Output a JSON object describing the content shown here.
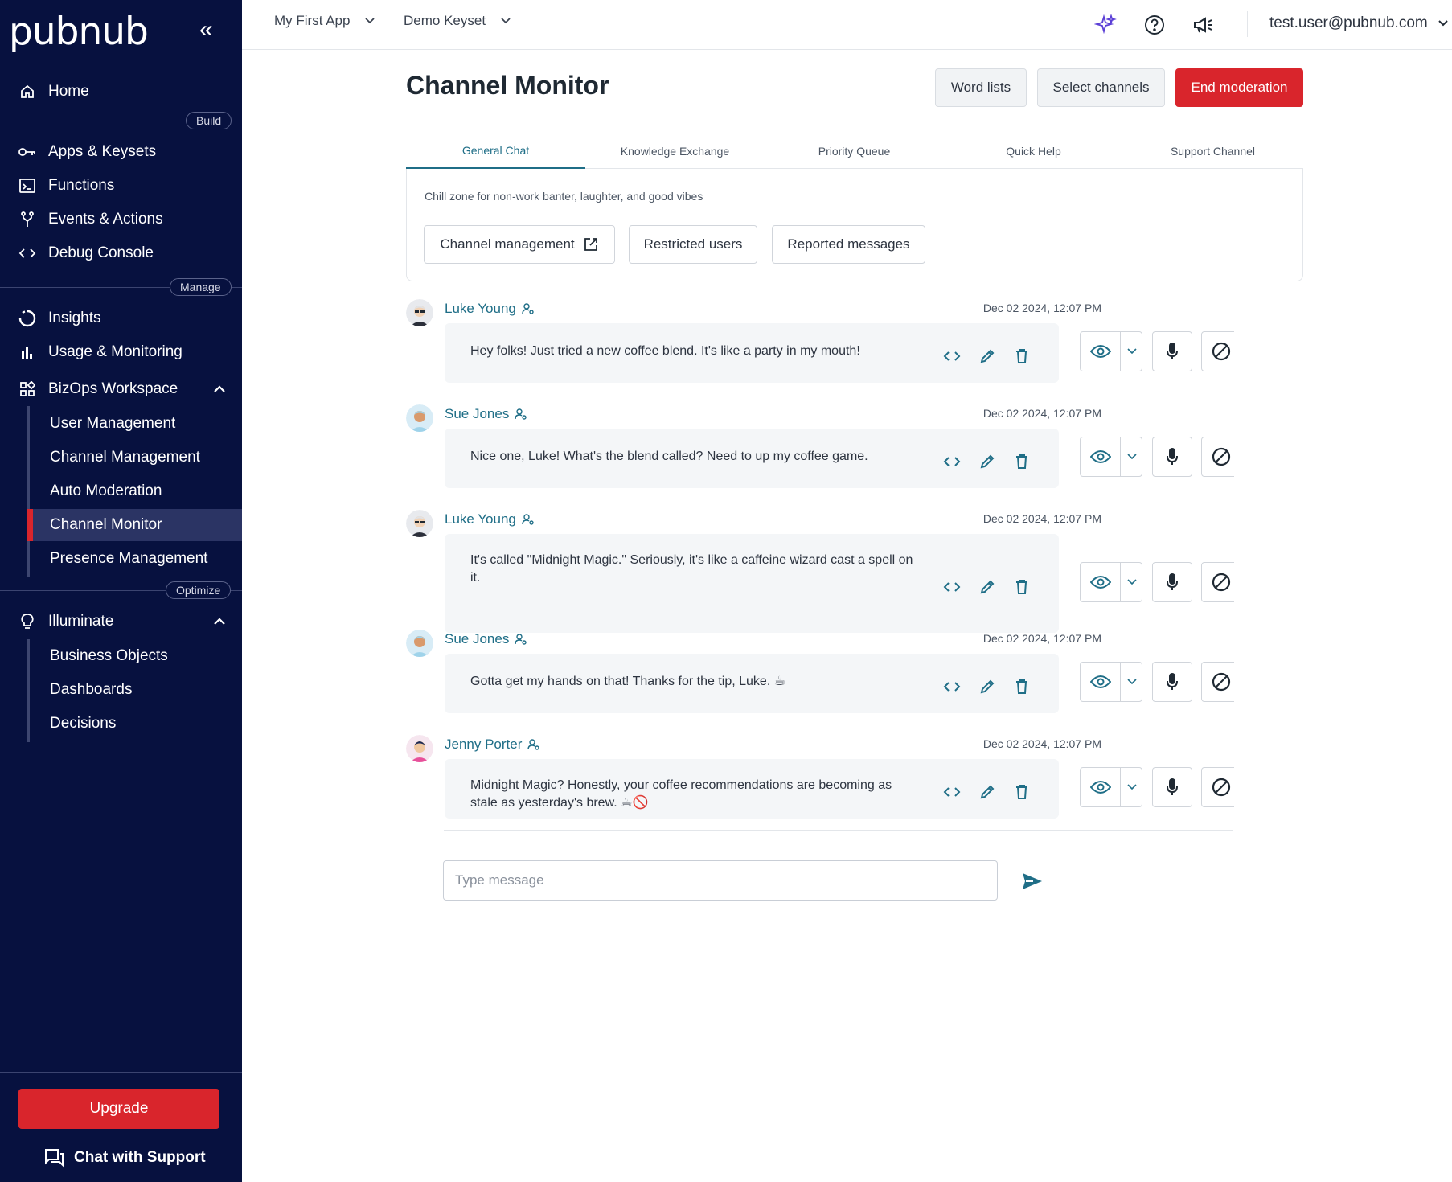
{
  "sidebar": {
    "logo": "pubnub",
    "collapse_glyph": "«",
    "home": "Home",
    "sections": {
      "build": "Build",
      "manage": "Manage",
      "optimize": "Optimize"
    },
    "build_items": [
      "Apps & Keysets",
      "Functions",
      "Events & Actions",
      "Debug Console"
    ],
    "manage_items": [
      "Insights",
      "Usage & Monitoring",
      "BizOps Workspace"
    ],
    "bizops_sub": [
      "User Management",
      "Channel Management",
      "Auto Moderation",
      "Channel Monitor",
      "Presence Management"
    ],
    "optimize_items": [
      "Illuminate"
    ],
    "illuminate_sub": [
      "Business Objects",
      "Dashboards",
      "Decisions"
    ],
    "upgrade": "Upgrade",
    "chat_support": "Chat with Support",
    "active_item": "Channel Monitor"
  },
  "topbar": {
    "app": "My First App",
    "keyset": "Demo Keyset",
    "user": "test.user@pubnub.com"
  },
  "main": {
    "title": "Channel Monitor",
    "buttons": {
      "word_lists": "Word lists",
      "select_channels": "Select channels",
      "end_moderation": "End moderation"
    },
    "tabs": [
      "General Chat",
      "Knowledge Exchange",
      "Priority Queue",
      "Quick Help",
      "Support Channel"
    ],
    "active_tab": "General Chat",
    "channel_description": "Chill zone for non-work banter, laughter, and good vibes",
    "channel_buttons": {
      "management": "Channel management",
      "restricted": "Restricted users",
      "reported": "Reported messages"
    },
    "messages": [
      {
        "author": "Luke Young",
        "time": "Dec 02 2024, 12:07 PM",
        "text": "Hey folks! Just tried a new coffee blend. It's like a party in my mouth!"
      },
      {
        "author": "Sue Jones",
        "time": "Dec 02 2024, 12:07 PM",
        "text": "Nice one, Luke! What's the blend called? Need to up my coffee game."
      },
      {
        "author": "Luke Young",
        "time": "Dec 02 2024, 12:07 PM",
        "text": "It's called \"Midnight Magic.\" Seriously, it's like a caffeine wizard cast a spell on it."
      },
      {
        "author": "Sue Jones",
        "time": "Dec 02 2024, 12:07 PM",
        "text": "Gotta get my hands on that! Thanks for the tip, Luke. ☕"
      },
      {
        "author": "Jenny Porter",
        "time": "Dec 02 2024, 12:07 PM",
        "text": "Midnight Magic? Honestly, your coffee recommendations are becoming as stale as yesterday's brew. ☕🚫"
      }
    ],
    "composer_placeholder": "Type message"
  },
  "colors": {
    "sidebar_bg": "#07113f",
    "accent_red": "#d9252c",
    "accent_teal": "#1f6e87"
  }
}
